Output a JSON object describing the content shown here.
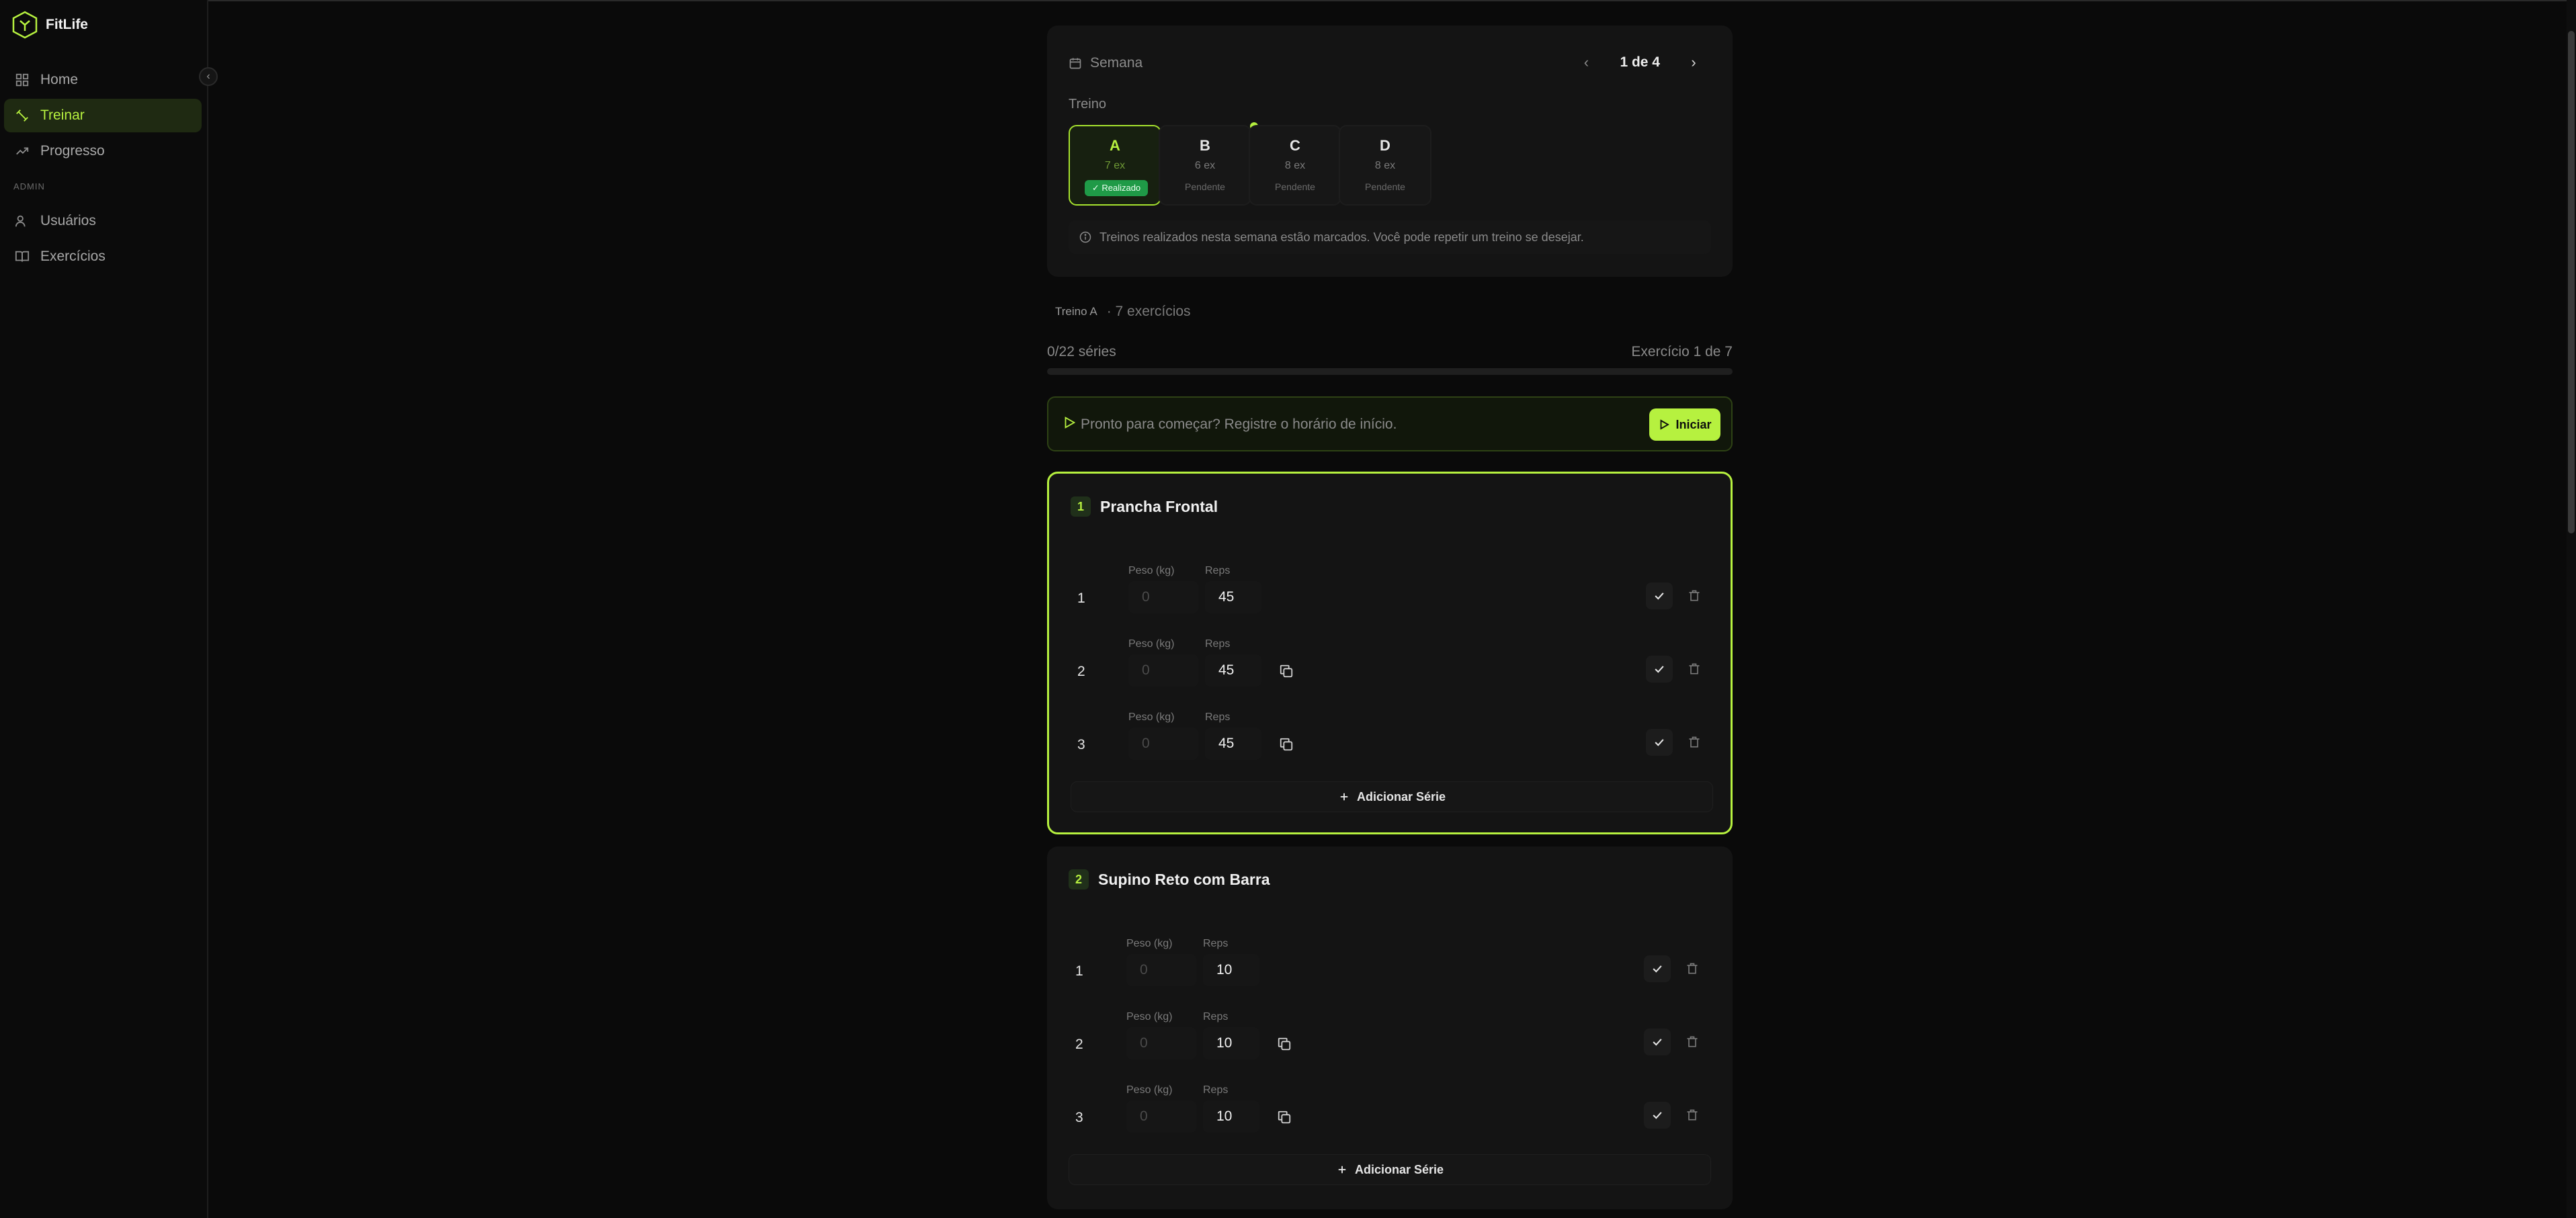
{
  "app": {
    "name": "FitLife"
  },
  "sidebar": {
    "section_admin": "ADMIN",
    "items": [
      {
        "label": "Home",
        "icon": "grid-icon"
      },
      {
        "label": "Treinar",
        "icon": "dumbbell-icon",
        "active": true
      },
      {
        "label": "Progresso",
        "icon": "trending-up-icon"
      },
      {
        "label": "Usuários",
        "icon": "users-icon"
      },
      {
        "label": "Exercícios",
        "icon": "book-icon"
      }
    ]
  },
  "week": {
    "label": "Semana",
    "page": "1 de 4",
    "treino_label": "Treino",
    "workouts": [
      {
        "letter": "A",
        "count": "7 ex",
        "status": "Realizado",
        "selected": true
      },
      {
        "letter": "B",
        "count": "6 ex",
        "status": "Pendente"
      },
      {
        "letter": "C",
        "count": "8 ex",
        "status": "Pendente"
      },
      {
        "letter": "D",
        "count": "8 ex",
        "status": "Pendente"
      }
    ],
    "info": "Treinos realizados nesta semana estão marcados. Você pode repetir um treino se desejar."
  },
  "session": {
    "workout": "Treino A",
    "subtitle": "· 7 exercícios",
    "series_progress": "0/22 séries",
    "exercise_progress": "Exercício 1 de 7",
    "progress_fraction": 0,
    "start_prompt": "Pronto para começar? Registre o horário de início.",
    "start_button": "Iniciar"
  },
  "labels": {
    "weight": "Peso (kg)",
    "reps": "Reps",
    "add_set": "Adicionar Série"
  },
  "exercises": [
    {
      "number": "1",
      "name": "Prancha Frontal",
      "sets": [
        {
          "n": "1",
          "weight_placeholder": "0",
          "reps": "45"
        },
        {
          "n": "2",
          "weight_placeholder": "0",
          "reps": "45"
        },
        {
          "n": "3",
          "weight_placeholder": "0",
          "reps": "45"
        }
      ]
    },
    {
      "number": "2",
      "name": "Supino Reto com Barra",
      "sets": [
        {
          "n": "1",
          "weight_placeholder": "0",
          "reps": "10"
        },
        {
          "n": "2",
          "weight_placeholder": "0",
          "reps": "10"
        },
        {
          "n": "3",
          "weight_placeholder": "0",
          "reps": "10"
        }
      ]
    }
  ],
  "colors": {
    "accent": "#b6f13f",
    "done_badge": "#1f9a47",
    "background": "#0a0a0a",
    "card": "#141414"
  }
}
